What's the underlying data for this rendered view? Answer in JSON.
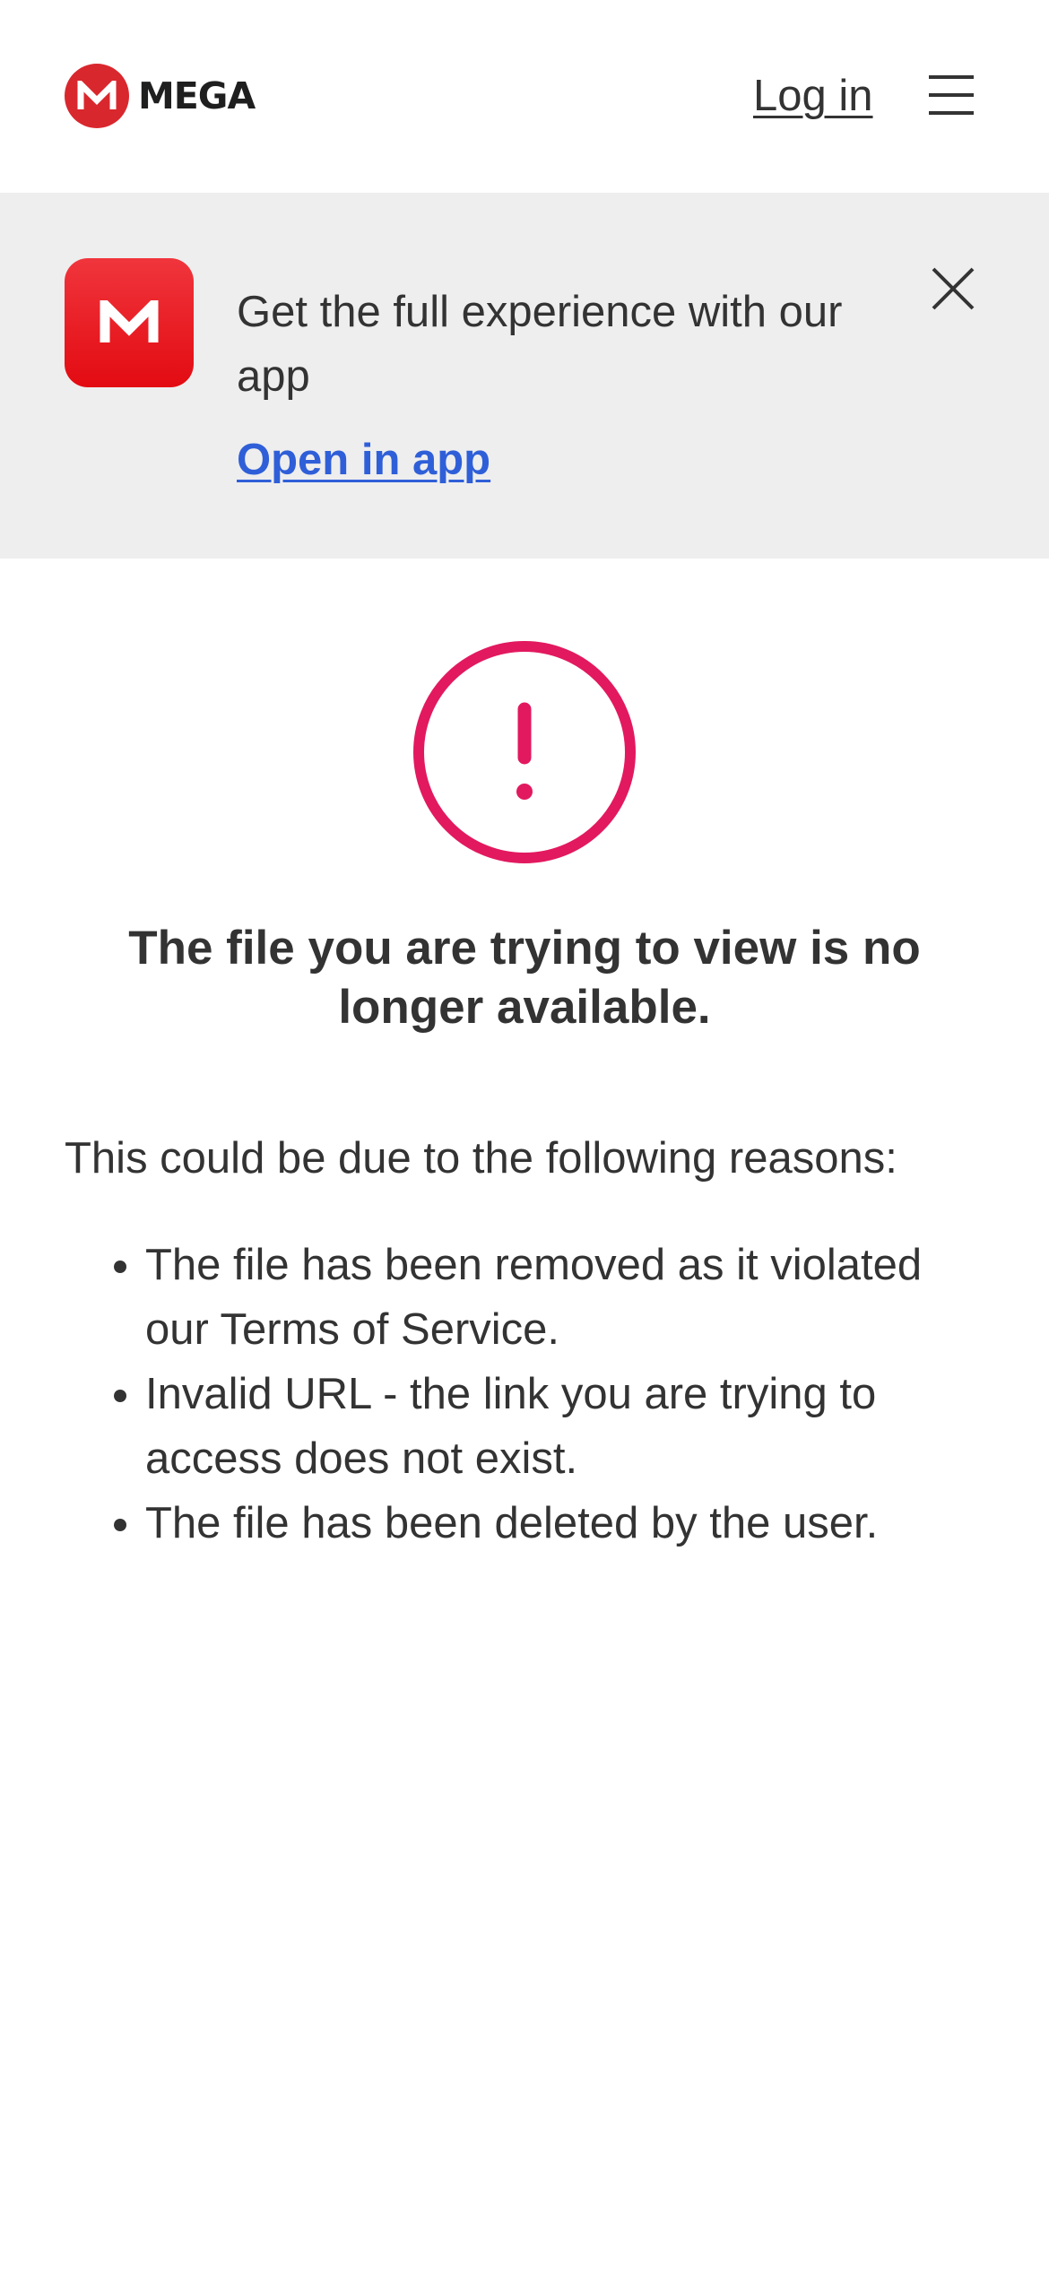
{
  "header": {
    "logo_text": "MEGA",
    "login_label": "Log in",
    "menu_icon": "hamburger-menu-icon"
  },
  "banner": {
    "app_icon": "mega-app-icon",
    "message": "Get the full experience with our app",
    "open_app_label": "Open in app",
    "close_icon": "close-icon"
  },
  "main": {
    "status_icon": "exclamation-circle-icon",
    "title": "The file you are trying to view is no longer available.",
    "reasons_intro": "This could be due to the following reasons:",
    "reasons": [
      "The file has been removed as it violated our Terms of Service.",
      "Invalid URL - the link you are trying to access does not exist.",
      "The file has been deleted by the user."
    ]
  },
  "colors": {
    "brand_red": "#d9272e",
    "alert_pink": "#e2195f",
    "link_blue": "#2f5fd8",
    "banner_bg": "#eeeeee",
    "text": "#333333"
  }
}
